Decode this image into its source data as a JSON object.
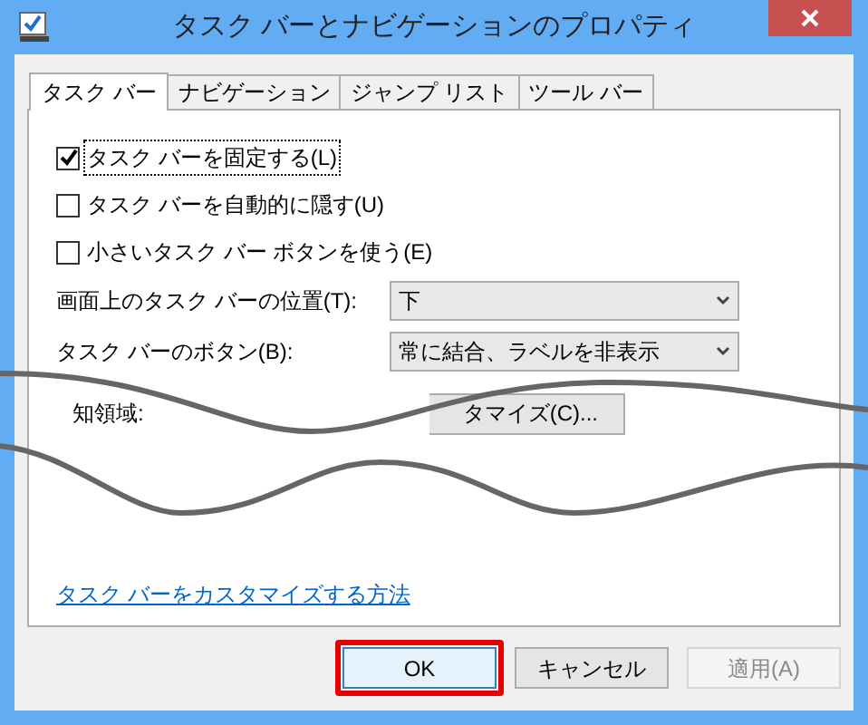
{
  "window": {
    "title": "タスク バーとナビゲーションのプロパティ"
  },
  "tabs": [
    {
      "label": "タスク バー",
      "selected": true
    },
    {
      "label": "ナビゲーション",
      "selected": false
    },
    {
      "label": "ジャンプ リスト",
      "selected": false
    },
    {
      "label": "ツール バー",
      "selected": false
    }
  ],
  "checkboxes": [
    {
      "label": "タスク バーを固定する(L)",
      "checked": true,
      "focused": true
    },
    {
      "label": "タスク バーを自動的に隠す(U)",
      "checked": false,
      "focused": false
    },
    {
      "label": "小さいタスク バー ボタンを使う(E)",
      "checked": false,
      "focused": false
    }
  ],
  "dropdowns": [
    {
      "label": "画面上のタスク バーの位置(T):",
      "value": "下"
    },
    {
      "label": "タスク バーのボタン(B):",
      "value": "常に結合、ラベルを非表示"
    }
  ],
  "notification_area": {
    "label": "知領域:",
    "button": "タマイズ(C)..."
  },
  "link": "タスク バーをカスタマイズする方法",
  "buttons": [
    {
      "label": "OK",
      "disabled": false,
      "highlighted": true
    },
    {
      "label": "キャンセル",
      "disabled": false,
      "highlighted": false
    },
    {
      "label": "適用(A)",
      "disabled": true,
      "highlighted": false
    }
  ]
}
